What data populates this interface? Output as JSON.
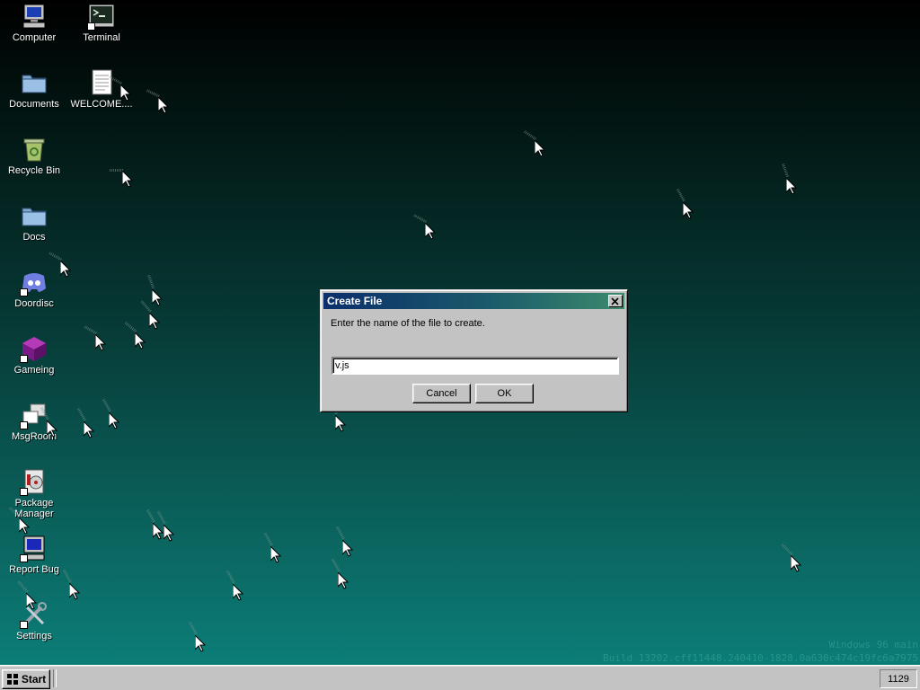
{
  "desktop": {
    "icons": [
      {
        "label": "Computer",
        "icon": "computer-icon",
        "name": "desktop-icon-computer"
      },
      {
        "label": "Terminal",
        "icon": "terminal-icon",
        "name": "desktop-icon-terminal"
      },
      {
        "label": "Documents",
        "icon": "folder-icon",
        "name": "desktop-icon-documents"
      },
      {
        "label": "WELCOME....",
        "icon": "text-document-icon",
        "name": "desktop-icon-welcome"
      },
      {
        "label": "Recycle Bin",
        "icon": "recycle-bin-icon",
        "name": "desktop-icon-recycle-bin"
      },
      {
        "label": "Docs",
        "icon": "folder-icon",
        "name": "desktop-icon-docs"
      },
      {
        "label": "Doordisc",
        "icon": "chat-app-icon",
        "name": "desktop-icon-doordisc"
      },
      {
        "label": "Gameing",
        "icon": "game-cube-icon",
        "name": "desktop-icon-gameing"
      },
      {
        "label": "MsgRoom",
        "icon": "message-room-icon",
        "name": "desktop-icon-msgroom"
      },
      {
        "label": "Package\nManager",
        "icon": "package-manager-icon",
        "name": "desktop-icon-package-manager"
      },
      {
        "label": "Report Bug",
        "icon": "bug-report-computer-icon",
        "name": "desktop-icon-report-bug"
      },
      {
        "label": "Settings",
        "icon": "settings-tools-icon",
        "name": "desktop-icon-settings"
      }
    ],
    "watermark": {
      "line1": "Windows 96 main",
      "line2": "Build 13202.cff11448.240410-1828.0a630c474c19fc6a7975"
    }
  },
  "dialog": {
    "title": "Create File",
    "prompt": "Enter the name of the file to create.",
    "input_value": "v.js",
    "cancel_label": "Cancel",
    "ok_label": "OK"
  },
  "taskbar": {
    "start_label": "Start",
    "clock": "1129"
  },
  "colors": {
    "desktop_top": "#000000",
    "desktop_bottom": "#0c7d77",
    "titlebar_start": "#0b2f6b",
    "titlebar_end": "#3c8a6d",
    "face": "#c3c3c3"
  }
}
